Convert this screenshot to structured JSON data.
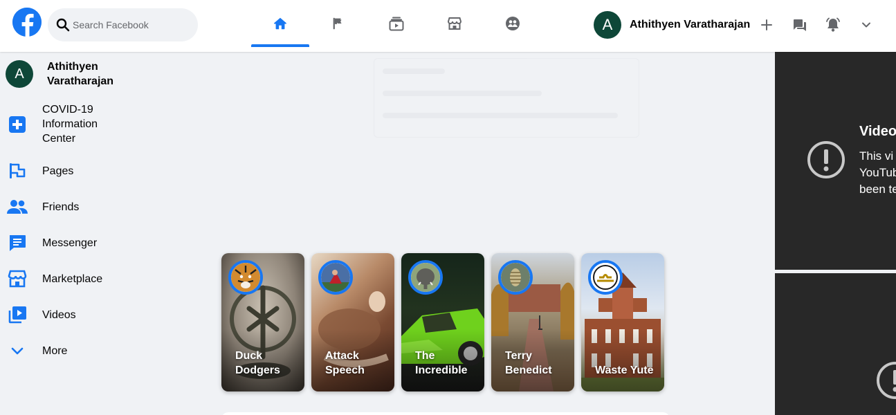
{
  "header": {
    "logo": "facebook-logo",
    "search_placeholder": "Search Facebook",
    "nav_tabs": [
      {
        "name": "home",
        "icon": "home-icon",
        "active": true
      },
      {
        "name": "pages",
        "icon": "flag-icon",
        "active": false
      },
      {
        "name": "watch",
        "icon": "watch-icon",
        "active": false
      },
      {
        "name": "marketplace",
        "icon": "marketplace-icon",
        "active": false
      },
      {
        "name": "groups",
        "icon": "groups-icon",
        "active": false
      }
    ],
    "profile": {
      "initial": "A",
      "name": "Athithyen Varatharajan"
    },
    "actions": [
      "plus-icon",
      "messenger-icon",
      "notifications-icon",
      "chevron-down-icon"
    ]
  },
  "sidebar": {
    "profile": {
      "initial": "A",
      "name": "Athithyen\nVaratharajan"
    },
    "items": [
      {
        "label": "COVID-19\nInformation\nCenter",
        "icon": "covid-info-icon"
      },
      {
        "label": "Pages",
        "icon": "flag-icon"
      },
      {
        "label": "Friends",
        "icon": "friends-icon"
      },
      {
        "label": "Messenger",
        "icon": "messenger-icon"
      },
      {
        "label": "Marketplace",
        "icon": "marketplace-icon"
      },
      {
        "label": "Videos",
        "icon": "videos-icon"
      },
      {
        "label": "More",
        "icon": "chevron-down-icon"
      }
    ]
  },
  "stories": [
    {
      "title": "Duck\nDodgers",
      "avatar": "tiger"
    },
    {
      "title": "Attack\nSpeech",
      "avatar": "person-red"
    },
    {
      "title": "The\nIncredible",
      "avatar": "elephant"
    },
    {
      "title": "Terry\nBenedict",
      "avatar": "pinecone"
    },
    {
      "title": "Waste Yute",
      "avatar": "libra-sign"
    }
  ],
  "video_panel": {
    "title": "Video",
    "message": "This vi\nYouTub\nbeen te",
    "icon": "warning-icon"
  },
  "colors": {
    "accent": "#1877f2",
    "avatar_bg": "#0e4738",
    "page_bg": "#f0f2f5",
    "video_bg": "#282828"
  }
}
